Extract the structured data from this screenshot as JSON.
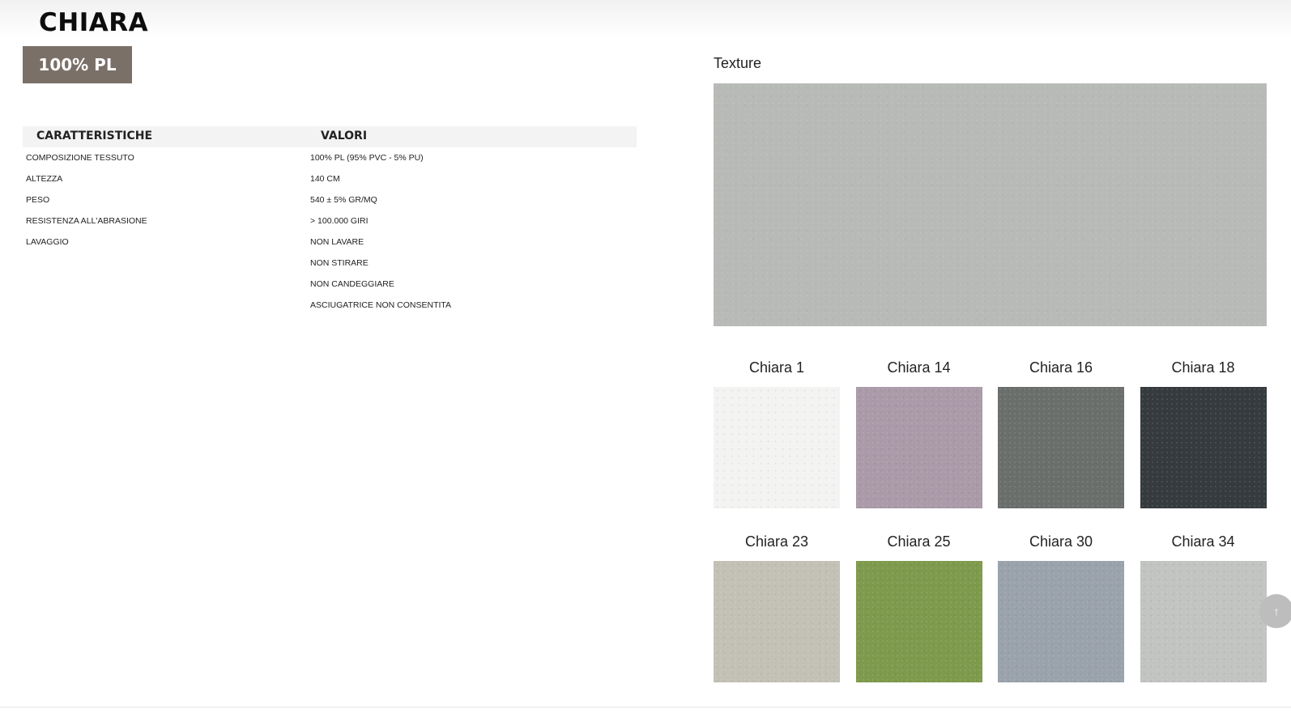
{
  "product": {
    "name": "CHIARA",
    "composition_badge": "100% PL"
  },
  "spec_table": {
    "headers": [
      "CARATTERISTICHE",
      "VALORI"
    ],
    "rows": [
      {
        "key": "COMPOSIZIONE TESSUTO",
        "value": "100% PL (95% PVC - 5% PU)"
      },
      {
        "key": "ALTEZZA",
        "value": "140 CM"
      },
      {
        "key": "PESO",
        "value": "540 ± 5% GR/MQ"
      },
      {
        "key": "RESISTENZA ALL'ABRASIONE",
        "value": "> 100.000 GIRI"
      },
      {
        "key": "LAVAGGIO",
        "value": "NON LAVARE"
      },
      {
        "key": "",
        "value": "NON STIRARE"
      },
      {
        "key": "",
        "value": "NON CANDEGGIARE"
      },
      {
        "key": "",
        "value": "ASCIUGATRICE NON CONSENTITA"
      }
    ]
  },
  "texture": {
    "label": "Texture",
    "color": "#b8bab7"
  },
  "swatches": [
    {
      "label": "Chiara 1",
      "color": "#f3f3f2"
    },
    {
      "label": "Chiara 14",
      "color": "#ab9aa9"
    },
    {
      "label": "Chiara 16",
      "color": "#6a6f6c"
    },
    {
      "label": "Chiara 18",
      "color": "#353b3e"
    },
    {
      "label": "Chiara 23",
      "color": "#c3c1b5"
    },
    {
      "label": "Chiara 25",
      "color": "#7e9a4c"
    },
    {
      "label": "Chiara 30",
      "color": "#9aa2ab"
    },
    {
      "label": "Chiara 34",
      "color": "#c2c4c1"
    }
  ],
  "scroll_top": {
    "icon": "arrow-up-icon",
    "glyph": "↑"
  }
}
